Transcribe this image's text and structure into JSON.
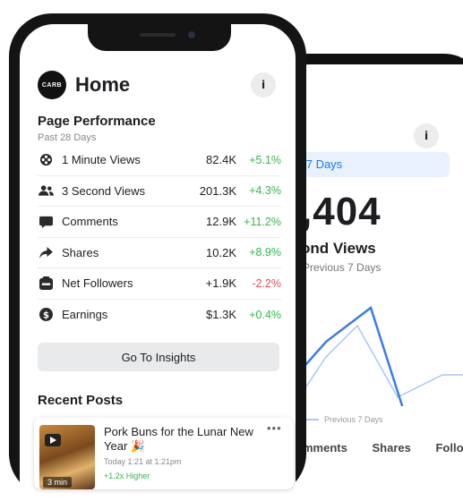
{
  "back_screen": {
    "range_label": "st 7 Days",
    "big_value": ",404",
    "metric_label": "ond Views",
    "compare_label": "Previous 7 Days",
    "legend_label": "Previous 7 Days",
    "tabs": [
      "mments",
      "Shares",
      "Follo"
    ]
  },
  "header": {
    "avatar_text": "CARB",
    "title": "Home"
  },
  "performance": {
    "title": "Page Performance",
    "subtitle": "Past 28 Days",
    "metrics": [
      {
        "icon": "film-reel-icon",
        "label": "1 Minute Views",
        "value": "82.4K",
        "change": "+5.1%",
        "trend": "up"
      },
      {
        "icon": "people-icon",
        "label": "3 Second Views",
        "value": "201.3K",
        "change": "+4.3%",
        "trend": "up"
      },
      {
        "icon": "comment-icon",
        "label": "Comments",
        "value": "12.9K",
        "change": "+11.2%",
        "trend": "up"
      },
      {
        "icon": "share-arrow-icon",
        "label": "Shares",
        "value": "10.2K",
        "change": "+8.9%",
        "trend": "up"
      },
      {
        "icon": "follower-icon",
        "label": "Net Followers",
        "value": "+1.9K",
        "change": "-2.2%",
        "trend": "down"
      },
      {
        "icon": "dollar-icon",
        "label": "Earnings",
        "value": "$1.3K",
        "change": "+0.4%",
        "trend": "up"
      }
    ],
    "insights_button": "Go To Insights"
  },
  "recent_posts": {
    "title": "Recent Posts",
    "posts": [
      {
        "title": "Pork Buns for the Lunar New Year 🎉",
        "meta": "Today 1:21 at 1:21pm",
        "stat": "+1.2x Higher",
        "duration": "3 min"
      }
    ]
  },
  "colors": {
    "positive": "#30b94d",
    "negative": "#e64a5f",
    "accent": "#1877f2"
  }
}
